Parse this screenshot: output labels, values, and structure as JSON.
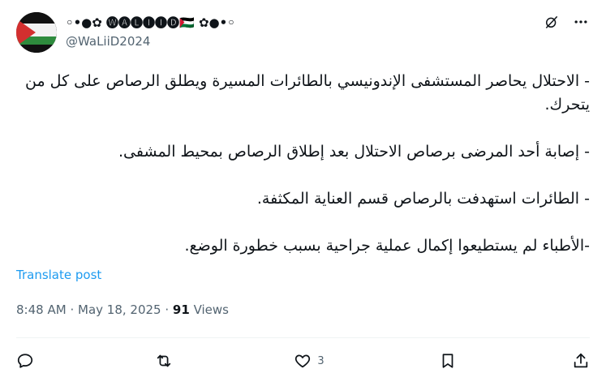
{
  "author": {
    "display_name": "◦•●✿ 🅦🅐🅛🅘🅘🅓🇵🇸 ✿●•◦",
    "handle": "@WaLiiD2024"
  },
  "post": {
    "lines": [
      "- الاحتلال يحاصر المستشفى الإندونيسي بالطائرات المسيرة ويطلق الرصاص على كل من يتحرك.",
      "",
      "- إصابة أحد المرضى برصاص الاحتلال بعد إطلاق الرصاص بمحيط المشفى.",
      "",
      "- الطائرات استهدفت بالرصاص قسم العناية المكثفة.",
      "",
      "-الأطباء لم يستطيعوا إكمال عملية جراحية بسبب خطورة الوضع."
    ]
  },
  "translate_label": "Translate post",
  "meta": {
    "time": "8:48 AM",
    "separator": "·",
    "date": "May 18, 2025",
    "views_count": "91",
    "views_label": "Views"
  },
  "actions": {
    "reply_count": "",
    "repost_count": "",
    "like_count": "3"
  },
  "icons": {
    "grok": "grok-icon",
    "more": "more-icon",
    "reply": "reply-icon",
    "repost": "repost-icon",
    "like": "like-icon",
    "bookmark": "bookmark-icon",
    "share": "share-icon"
  },
  "colors": {
    "text": "#0f1419",
    "secondary": "#536471",
    "link": "#1d9bf0",
    "divider": "#eff3f4"
  }
}
